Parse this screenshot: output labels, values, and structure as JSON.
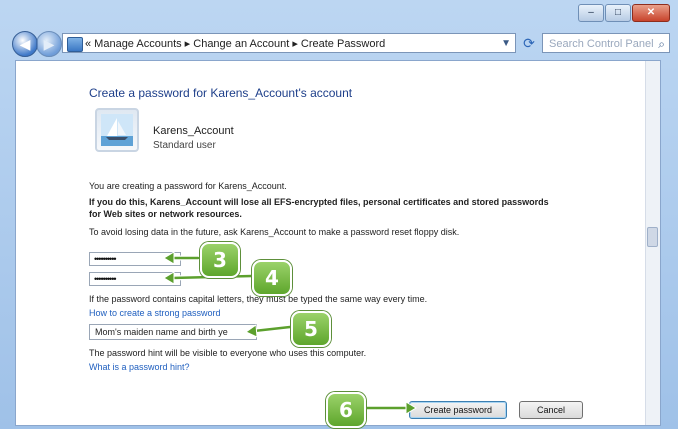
{
  "window": {
    "controls": [
      "–",
      "□",
      "✕"
    ]
  },
  "address_bar": {
    "back_icon": "back-arrow-icon",
    "forward_icon": "forward-arrow-icon",
    "path": "« Manage Accounts ▸ Change an Account ▸ Create Password",
    "search_placeholder": "Search Control Panel"
  },
  "page": {
    "heading": "Create a password for Karens_Account's account",
    "account": {
      "name": "Karens_Account",
      "type": "Standard user"
    },
    "info_line": "You are creating a password for Karens_Account.",
    "warning_line1": "If you do this, Karens_Account will lose all EFS-encrypted files, personal certificates and stored passwords",
    "warning_line2": "for Web sites or network resources.",
    "avoid_line": "To avoid losing data in the future, ask Karens_Account to make a password reset floppy disk.",
    "password_value": "••••••••••",
    "confirm_value": "••••••••••",
    "caps_note": "If the password contains capital letters, they must be typed the same way every time.",
    "strong_link": "How to create a strong password",
    "hint_value": "Mom's maiden name and birth ye",
    "hint_note": "The password hint will be visible to everyone who uses this computer.",
    "hint_link": "What is a password hint?",
    "create_button": "Create password",
    "cancel_button": "Cancel"
  },
  "callouts": [
    "3",
    "4",
    "5",
    "6"
  ],
  "colors": {
    "callout": "#6fb23a",
    "link": "#1f5fbf",
    "heading": "#1e3f8a"
  }
}
